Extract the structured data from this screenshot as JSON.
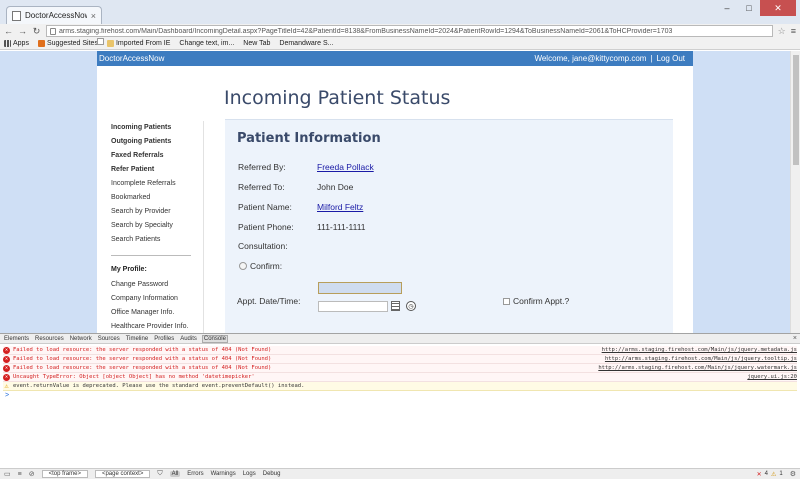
{
  "browser": {
    "tab_title": "DoctorAccessNow",
    "url": "arms.staging.firehost.com/Main/Dashboard/IncomingDetail.aspx?PageTitleId=42&PatientId=8138&FromBusinessNameId=2024&PatientRowId=1294&ToBusinessNameId=2061&ToHCProvider=1703",
    "bookmarks": [
      {
        "label": "Apps",
        "icon": "apps-grid-icon"
      },
      {
        "label": "Suggested Sites",
        "icon": "suggested-sites-icon"
      },
      {
        "label": "Imported From IE",
        "icon": "folder-icon"
      },
      {
        "label": "Change text, im...",
        "icon": "page-icon"
      },
      {
        "label": "New Tab",
        "icon": "page-icon"
      },
      {
        "label": "Demandware S...",
        "icon": "page-icon"
      }
    ]
  },
  "site": {
    "brand": "DoctorAccessNow",
    "welcome_text": "Welcome, jane@kittycomp.com",
    "separator": "|",
    "logout": "Log Out",
    "page_title": "Incoming Patient Status"
  },
  "sidebar": {
    "links": [
      {
        "label": "Incoming Patients",
        "bold": true
      },
      {
        "label": "Outgoing Patients",
        "bold": true
      },
      {
        "label": "Faxed Referrals",
        "bold": true
      },
      {
        "label": "Refer Patient",
        "bold": true
      },
      {
        "label": "Incomplete Referrals",
        "bold": false
      },
      {
        "label": "Bookmarked",
        "bold": false
      },
      {
        "label": "Search by Provider",
        "bold": false
      },
      {
        "label": "Search by Specialty",
        "bold": false
      },
      {
        "label": "Search Patients",
        "bold": false
      }
    ],
    "profile_heading": "My Profile:",
    "profile_links": [
      "Change Password",
      "Company Information",
      "Office Manager Info.",
      "Healthcare Provider Info."
    ]
  },
  "patient_info": {
    "title": "Patient Information",
    "referred_by_label": "Referred By:",
    "referred_by": "Freeda Pollack",
    "referred_to_label": "Referred To:",
    "referred_to": "John Doe",
    "patient_name_label": "Patient Name:",
    "patient_name": "Milford Feltz",
    "patient_phone_label": "Patient Phone:",
    "patient_phone": "111-111-1111",
    "consultation_label": "Consultation:",
    "confirm_label": "Confirm:",
    "appt_label": "Appt. Date/Time:",
    "confirm_appt_label": "Confirm Appt.?"
  },
  "devtools": {
    "tabs": [
      "Elements",
      "Resources",
      "Network",
      "Sources",
      "Timeline",
      "Profiles",
      "Audits",
      "Console"
    ],
    "active_tab": "Console",
    "logs": [
      {
        "type": "error",
        "message": "Failed to load resource: the server responded with a status of 404 (Not Found)",
        "source": "http://arms.staging.firehost.com/Main/js/jquery.metadata.js"
      },
      {
        "type": "error",
        "message": "Failed to load resource: the server responded with a status of 404 (Not Found)",
        "source": "http://arms.staging.firehost.com/Main/js/jquery.tooltip.js"
      },
      {
        "type": "error",
        "message": "Failed to load resource: the server responded with a status of 404 (Not Found)",
        "source": "http://arms.staging.firehost.com/Main/js/jquery.watermark.js"
      },
      {
        "type": "error",
        "message": "Uncaught TypeError: Object [object Object] has no method 'datetimepicker'",
        "source": "jquery.ui.js:20"
      },
      {
        "type": "warning",
        "message": "event.returnValue is deprecated. Please use the standard event.preventDefault() instead.",
        "source": ""
      }
    ],
    "prompt": ">",
    "frame_select": "<top frame>",
    "context_select": "<page context>",
    "filters": [
      "All",
      "Errors",
      "Warnings",
      "Logs",
      "Debug"
    ],
    "active_filter": "All",
    "error_count": "4",
    "warning_count": "1"
  }
}
